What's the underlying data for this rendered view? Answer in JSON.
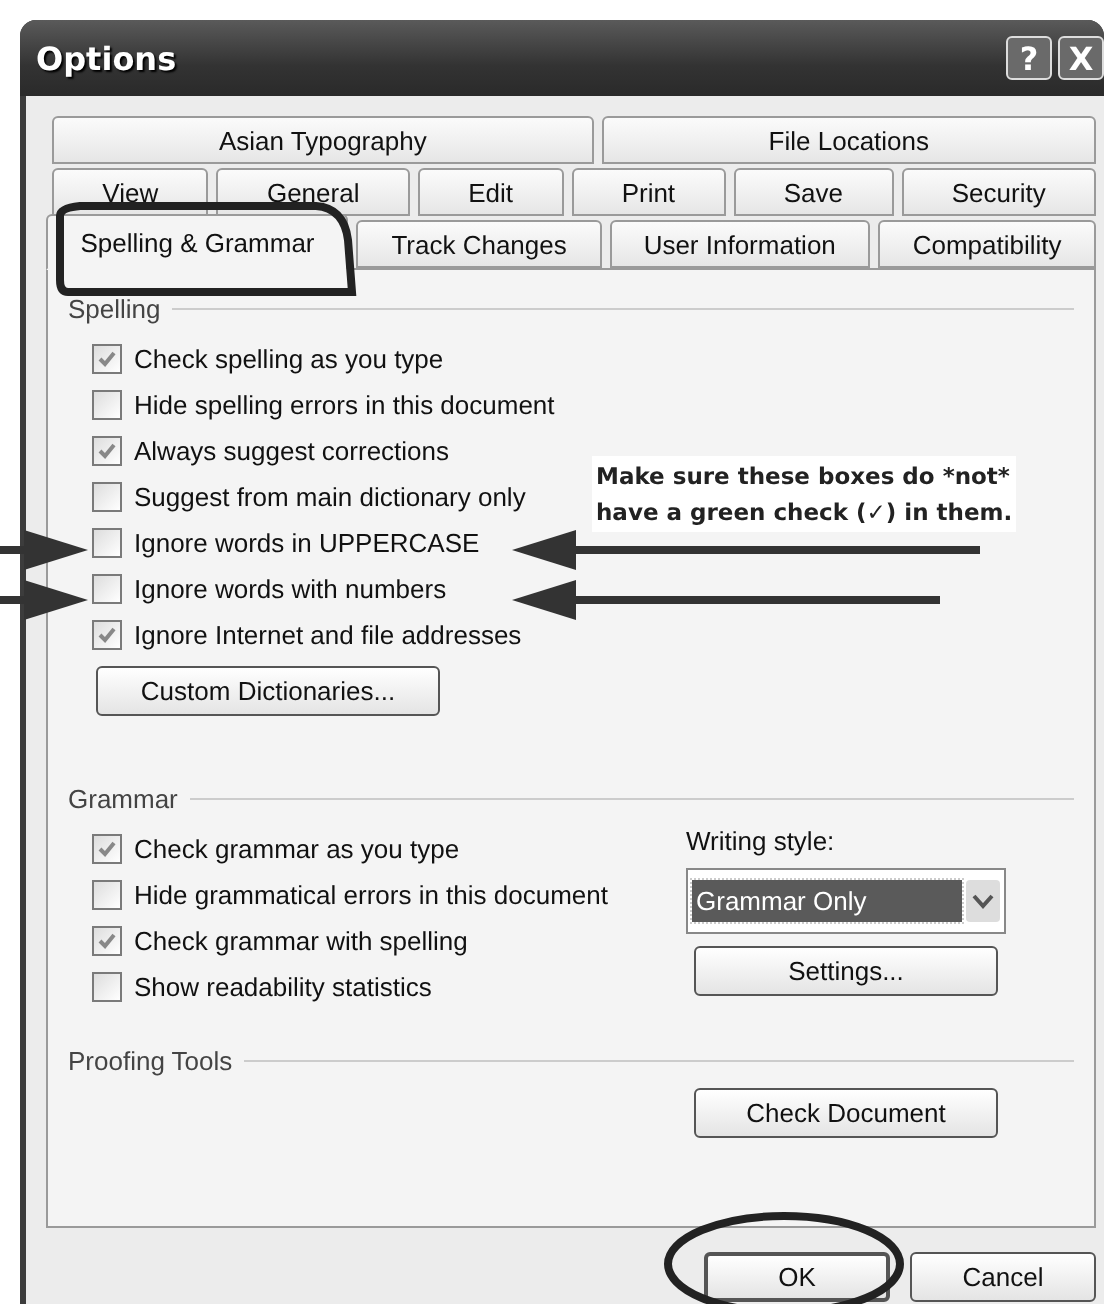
{
  "window": {
    "title": "Options",
    "title_buttons": [
      "?",
      "X"
    ]
  },
  "tab_rows": [
    [
      {
        "label": "Asian Typography",
        "selected": false
      },
      {
        "label": "File Locations",
        "selected": false
      }
    ],
    [
      {
        "label": "View",
        "selected": false
      },
      {
        "label": "General",
        "selected": false
      },
      {
        "label": "Edit",
        "selected": false
      },
      {
        "label": "Print",
        "selected": false
      },
      {
        "label": "Save",
        "selected": false
      },
      {
        "label": "Security",
        "selected": false
      }
    ],
    [
      {
        "label": "Spelling & Grammar",
        "selected": true
      },
      {
        "label": "Track Changes",
        "selected": false
      },
      {
        "label": "User Information",
        "selected": false
      },
      {
        "label": "Compatibility",
        "selected": false
      }
    ]
  ],
  "spelling": {
    "title": "Spelling",
    "options": [
      {
        "label": "Check spelling as you type",
        "checked": true
      },
      {
        "label": "Hide spelling errors in this document",
        "checked": false
      },
      {
        "label": "Always suggest corrections",
        "checked": true
      },
      {
        "label": "Suggest from main dictionary only",
        "checked": false
      },
      {
        "label": "Ignore words in UPPERCASE",
        "checked": false
      },
      {
        "label": "Ignore words with numbers",
        "checked": false
      },
      {
        "label": "Ignore Internet and file addresses",
        "checked": true
      }
    ],
    "button": "Custom Dictionaries..."
  },
  "grammar": {
    "title": "Grammar",
    "options": [
      {
        "label": "Check grammar as you type",
        "checked": true
      },
      {
        "label": "Hide grammatical errors in this document",
        "checked": false
      },
      {
        "label": "Check grammar with spelling",
        "checked": true
      },
      {
        "label": "Show readability statistics",
        "checked": false
      }
    ],
    "writing_style": {
      "label": "Writing style:",
      "value": "Grammar Only",
      "highlighted": true
    },
    "button": "Settings..."
  },
  "proofing_tools": {
    "title": "Proofing Tools",
    "button": "Check Document"
  },
  "footer_buttons": [
    {
      "label": "OK",
      "focused": true
    },
    {
      "label": "Cancel",
      "focused": false
    }
  ],
  "annotation": {
    "lines": [
      "Make sure these boxes do *not*",
      "have a green check (✓) in them."
    ]
  }
}
